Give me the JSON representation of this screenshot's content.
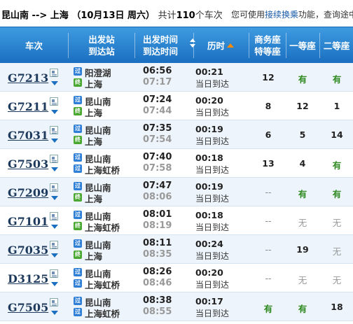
{
  "top": {
    "from": "昆山南",
    "arrow": "-->",
    "to": "上海",
    "date": "（10月13日  周六）",
    "total_pre": "共计",
    "total_count": "110",
    "total_post": "个车次",
    "notice_pre": "您可使用",
    "notice_link": "接续换乘",
    "notice_post": "功能，查询途中"
  },
  "header": {
    "train": "车次",
    "station_l1": "出发站",
    "station_l2": "到达站",
    "time_l1": "出发时间",
    "time_l2": "到达时间",
    "duration": "历时",
    "business_l1": "商务座",
    "business_l2": "特等座",
    "first": "一等座",
    "second": "二等座"
  },
  "rows": [
    {
      "train": "G7213",
      "from_badge": "过",
      "from": "阳澄湖",
      "to_badge": "终",
      "to": "上海",
      "dep": "06:56",
      "arr": "07:17",
      "dur": "00:21",
      "day": "当日到达",
      "s1": "12",
      "s2": "有",
      "s3": "有"
    },
    {
      "train": "G7211",
      "from_badge": "过",
      "from": "昆山南",
      "to_badge": "终",
      "to": "上海",
      "dep": "07:24",
      "arr": "07:44",
      "dur": "00:20",
      "day": "当日到达",
      "s1": "8",
      "s2": "12",
      "s3": "1"
    },
    {
      "train": "G7031",
      "from_badge": "过",
      "from": "昆山南",
      "to_badge": "终",
      "to": "上海",
      "dep": "07:35",
      "arr": "07:54",
      "dur": "00:19",
      "day": "当日到达",
      "s1": "6",
      "s2": "5",
      "s3": "14"
    },
    {
      "train": "G7503",
      "from_badge": "过",
      "from": "昆山南",
      "to_badge": "过",
      "to": "上海虹桥",
      "dep": "07:40",
      "arr": "07:58",
      "dur": "00:18",
      "day": "当日到达",
      "s1": "13",
      "s2": "4",
      "s3": "有"
    },
    {
      "train": "G7209",
      "from_badge": "过",
      "from": "昆山南",
      "to_badge": "终",
      "to": "上海",
      "dep": "07:47",
      "arr": "08:06",
      "dur": "00:19",
      "day": "当日到达",
      "s1": "--",
      "s2": "有",
      "s3": "有"
    },
    {
      "train": "G7101",
      "from_badge": "过",
      "from": "昆山南",
      "to_badge": "终",
      "to": "上海虹桥",
      "dep": "08:01",
      "arr": "08:19",
      "dur": "00:18",
      "day": "当日到达",
      "s1": "--",
      "s2": "无",
      "s3": "无"
    },
    {
      "train": "G7035",
      "from_badge": "过",
      "from": "昆山南",
      "to_badge": "终",
      "to": "上海",
      "dep": "08:11",
      "arr": "08:35",
      "dur": "00:24",
      "day": "当日到达",
      "s1": "--",
      "s2": "19",
      "s3": "无"
    },
    {
      "train": "D3125",
      "from_badge": "过",
      "from": "昆山南",
      "to_badge": "过",
      "to": "上海虹桥",
      "dep": "08:26",
      "arr": "08:46",
      "dur": "00:20",
      "day": "当日到达",
      "s1": "--",
      "s2": "无",
      "s3": "无"
    },
    {
      "train": "G7505",
      "from_badge": "过",
      "from": "昆山南",
      "to_badge": "过",
      "to": "上海虹桥",
      "dep": "08:38",
      "arr": "08:55",
      "dur": "00:17",
      "day": "当日到达",
      "s1": "有",
      "s2": "有",
      "s3": "18"
    }
  ],
  "colors": {
    "header_top": "#3f9be0",
    "header_bottom": "#1a6fc0",
    "available": "#2f8a22",
    "unavailable": "#999999",
    "link": "#1a5ba9"
  },
  "icons": {
    "info": "doc-icon",
    "expand": "chevron-down-icon",
    "sort_up": "sort-arrow-up-icon",
    "sort_down": "sort-arrow-down-icon"
  }
}
